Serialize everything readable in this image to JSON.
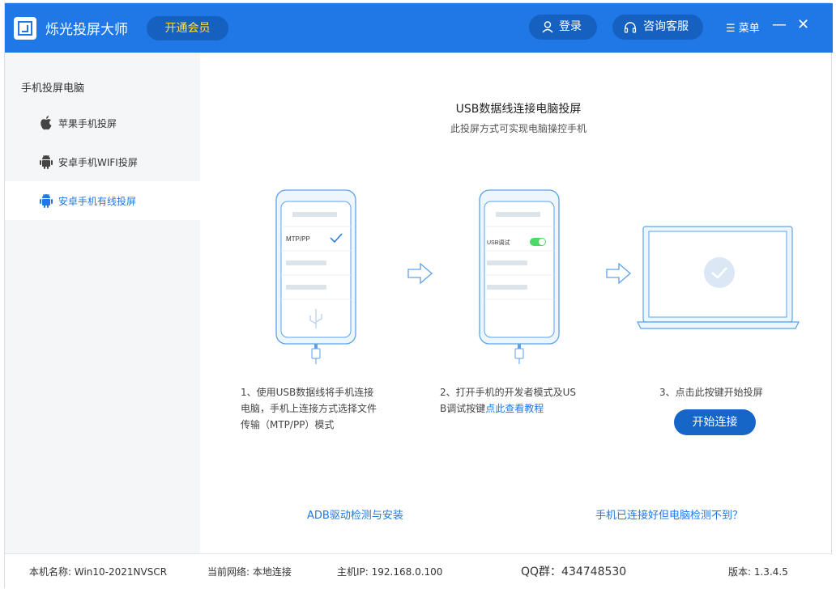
{
  "header": {
    "app_title": "烁光投屏大师",
    "vip_label": "开通会员",
    "login_label": "登录",
    "service_label": "咨询客服",
    "menu_label": "菜单",
    "minimize_glyph": "—",
    "close_glyph": "✕"
  },
  "sidebar": {
    "heading": "手机投屏电脑",
    "items": [
      {
        "label": "苹果手机投屏",
        "icon": "apple-icon",
        "active": false
      },
      {
        "label": "安卓手机WIFI投屏",
        "icon": "android-icon",
        "active": false
      },
      {
        "label": "安卓手机有线投屏",
        "icon": "android-icon",
        "active": true
      }
    ]
  },
  "main": {
    "title": "USB数据线连接电脑投屏",
    "subtitle": "此投屏方式可实现电脑操控手机",
    "phone1_label": "MTP/PP",
    "phone2_label": "USB调试",
    "step1_lines": [
      "1、使用USB数据线将手机连接",
      "电脑，手机上连接方式选择文件",
      "传输（MTP/PP）模式"
    ],
    "step2_line1": "2、打开手机的开发者模式及US",
    "step2_line2_prefix": "B调试按键",
    "step2_link": "点此查看教程",
    "step3_text": "3、点击此按键开始投屏",
    "start_button": "开始连接",
    "adb_link": "ADB驱动检测与安装",
    "help_link": "手机已连接好但电脑检测不到？"
  },
  "status": {
    "machine": "本机名称: Win10-2021NVSCR",
    "network": "当前网络: 本地连接",
    "ip": "主机IP: 192.168.0.100",
    "qq": "QQ群：434748530",
    "version": "版本: 1.3.4.5"
  },
  "colors": {
    "brand_blue": "#1f78e6",
    "vip_yellow": "#ffe044",
    "toggle_green": "#4cd964"
  }
}
